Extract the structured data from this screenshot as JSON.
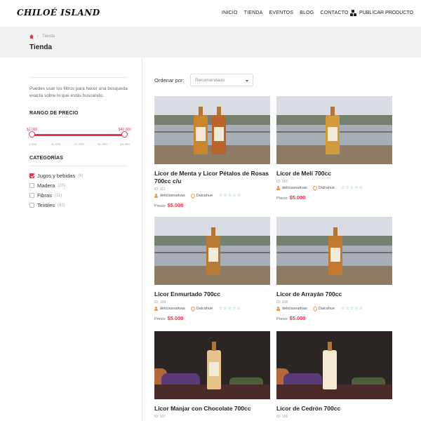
{
  "header": {
    "logo": "CHILOÉ ISLAND",
    "nav": [
      "INICIO",
      "TIENDA",
      "EVENTOS",
      "BLOG",
      "CONTACTO"
    ],
    "publish_label": "PUBLICAR PRODUCTO",
    "publish_icon": "boxes-icon"
  },
  "breadcrumb": {
    "home_icon": "home-icon",
    "current": "Tienda"
  },
  "page_title": "Tienda",
  "sidebar": {
    "intro": "Puedes usar los filtros para hacer una búsqueda exacta sobre lo que estás buscando.",
    "price_heading": "RANGO DE PRECIO",
    "price_min": "$1.000",
    "price_max": "$40.000",
    "price_ticks": [
      "1.000",
      "11.000",
      "21.000",
      "31.000",
      "40.000"
    ],
    "categories_heading": "CATEGORÍAS",
    "categories": [
      {
        "label": "Jugos y bebidas",
        "count": "(6)",
        "checked": true
      },
      {
        "label": "Madera",
        "count": "(20)",
        "checked": false
      },
      {
        "label": "Fibras",
        "count": "(11)",
        "checked": false
      },
      {
        "label": "Textiles",
        "count": "(83)",
        "checked": false
      }
    ]
  },
  "sort": {
    "label": "Ordenar por:",
    "value": "Recomendado"
  },
  "products": [
    {
      "name": "Licor de Menta y Licor Pétalos de Rosas 700cc c/u",
      "id": "ID: 111",
      "seller": "deliciasnativas",
      "location": "Dalcahue",
      "price_label": "Precio",
      "price": "$5.000"
    },
    {
      "name": "Licor de Melí 700cc",
      "id": "ID: 110",
      "seller": "deliciasnativas",
      "location": "Dalcahue",
      "price_label": "Precio",
      "price": "$5.000"
    },
    {
      "name": "Licor Enmurtado 700cc",
      "id": "ID: 109",
      "seller": "deliciasnativas",
      "location": "Dalcahue",
      "price_label": "Precio",
      "price": "$5.000"
    },
    {
      "name": "Licor de Arrayán 700cc",
      "id": "ID: 108",
      "seller": "deliciasnativas",
      "location": "Dalcahue",
      "price_label": "Precio",
      "price": "$5.000"
    },
    {
      "name": "Licor Manjar con Chocolate 700cc",
      "id": "ID: 107",
      "seller": "",
      "location": "",
      "price_label": "",
      "price": ""
    },
    {
      "name": "Licor de Cedrón 700cc",
      "id": "ID: 106",
      "seller": "",
      "location": "",
      "price_label": "",
      "price": ""
    }
  ],
  "colors": {
    "accent": "#e8334a",
    "stars": "#3bb58e",
    "meta_icons": "#e89b4b"
  }
}
